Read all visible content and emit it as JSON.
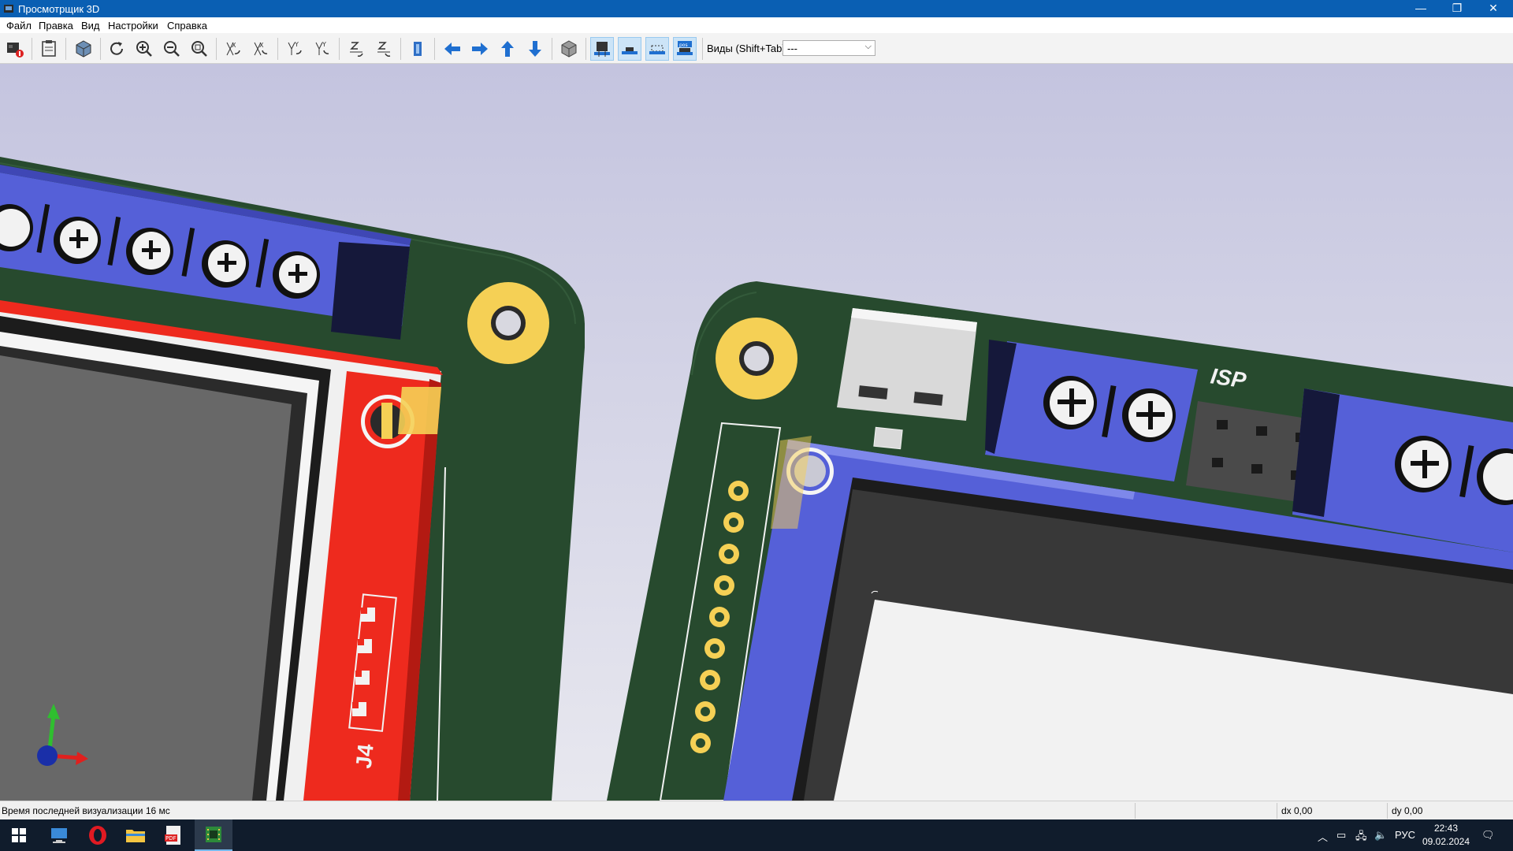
{
  "window": {
    "title": "Просмотрщик 3D",
    "minimize_glyph": "—",
    "restore_glyph": "❐",
    "close_glyph": "✕"
  },
  "menu": [
    "Файл",
    "Правка",
    "Вид",
    "Настройки",
    "Справка"
  ],
  "toolbar": {
    "buttons": [
      "export-image",
      "copy-to-clipboard",
      "render-mode",
      "reload-board",
      "zoom-in",
      "zoom-out",
      "zoom-fit",
      "rotate-x-cw",
      "rotate-x-ccw",
      "rotate-y-cw",
      "rotate-y-ccw",
      "rotate-z-cw",
      "rotate-z-ccw",
      "flip-board",
      "move-left",
      "move-right",
      "move-up",
      "move-down",
      "ortho-toggle",
      "toggle-tht",
      "toggle-smd",
      "toggle-virtual",
      "toggle-not-in-pos"
    ],
    "views_label": "Виды (Shift+Tab):",
    "views_value": "---"
  },
  "board": {
    "silkscreen_labels": [
      "ISP",
      "J4"
    ]
  },
  "status": {
    "render_time": "Время последней визуализации 16 мс",
    "dx": "dx 0,00",
    "dy": "dy 0,00"
  },
  "taskbar": {
    "apps": [
      "start",
      "remote-desktop",
      "opera",
      "file-explorer",
      "pdf-reader",
      "kicad-3d-viewer"
    ],
    "language": "РУС",
    "time": "22:43",
    "date": "09.02.2024"
  },
  "colors": {
    "background_top": "#c4c4df",
    "background_bottom": "#e6e6ee",
    "board_green": "#274a2e",
    "silkscreen": "#f2f2f2",
    "pad_gold": "#f5d055",
    "terminal_blue": "#5560d8",
    "display_red": "#ee2a1e",
    "titlebar": "#0a5fb3",
    "taskbar": "#101c2c"
  }
}
